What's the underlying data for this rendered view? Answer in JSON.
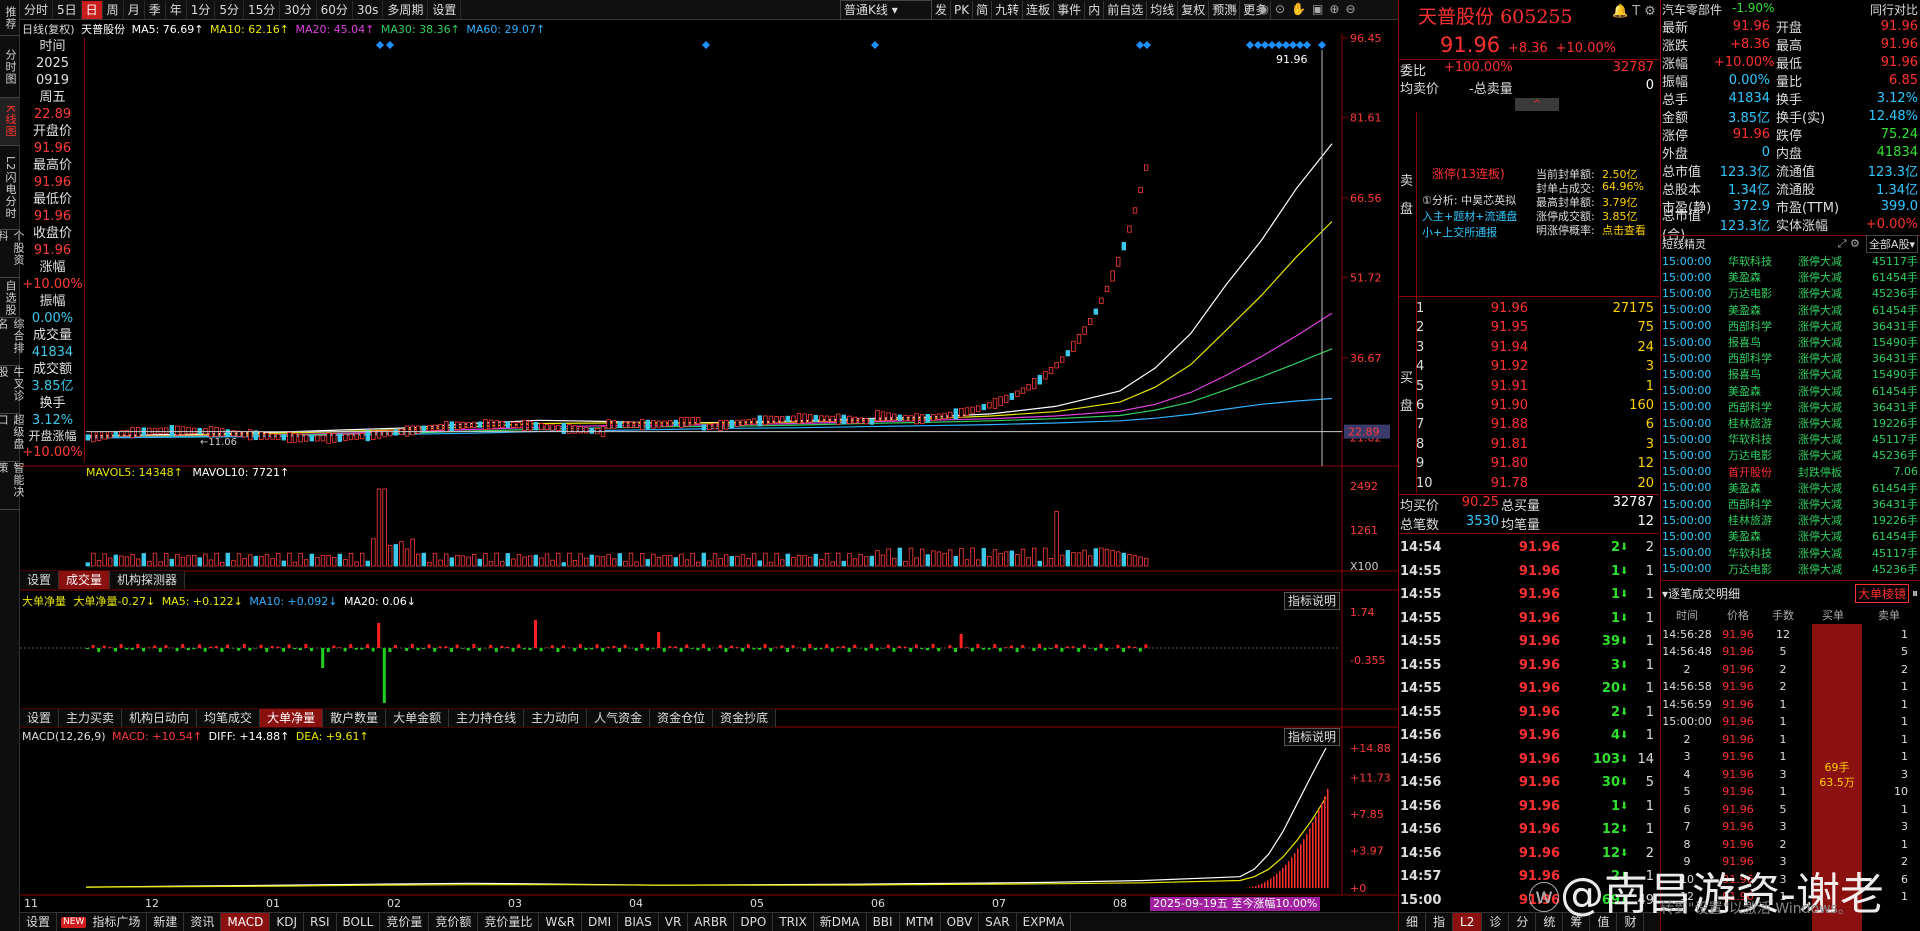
{
  "left_sidebar": [
    "推荐",
    "分时图",
    "K线图",
    "L2闪电分时",
    "个股资料",
    "自选股",
    "综合排名",
    "牛叉诊股",
    "超级盘口",
    "智能决策"
  ],
  "top_tabs": [
    "分时",
    "5日",
    "日",
    "周",
    "月",
    "季",
    "年",
    "1分",
    "5分",
    "15分",
    "30分",
    "60分",
    "30s",
    "多周期",
    "设置"
  ],
  "top_tabs_active": "日",
  "top_right": {
    "kline_type": "普通K线",
    "buttons": [
      "发",
      "PK",
      "简",
      "九转",
      "连板",
      "事件",
      "内",
      "前自选",
      "均线",
      "复权",
      "预测",
      "更多"
    ]
  },
  "stock": {
    "name": "天普股份",
    "code": "605255",
    "price": "91.96",
    "change": "+8.36",
    "change_pct": "+10.00%",
    "price_line": "91.96",
    "last_close_mark": "22.89"
  },
  "chart_header": {
    "mode": "日线(复权)",
    "name": "天普股份",
    "ma5": "MA5: 76.69↑",
    "ma10": "MA10: 62.16↑",
    "ma20": "MA20: 45.04↑",
    "ma30": "MA30: 38.36↑",
    "ma60": "MA60: 29.07↑"
  },
  "info_col": {
    "time_label": "时间",
    "year": "2025",
    "date": "0919",
    "weekday": "周五",
    "date_val": "22.89",
    "open_label": "开盘价",
    "open": "91.96",
    "high_label": "最高价",
    "high": "91.96",
    "low_label": "最低价",
    "low": "91.96",
    "close_label": "收盘价",
    "close": "91.96",
    "chg_label": "涨幅",
    "chg": "+10.00%",
    "amp_label": "振幅",
    "amp": "0.00%",
    "vol_label": "成交量",
    "vol": "41834",
    "amt_label": "成交额",
    "amt": "3.85亿",
    "turn_label": "换手",
    "turn": "3.12%",
    "open_chg_label": "开盘涨幅",
    "open_chg": "+10.00%"
  },
  "chart_data": [
    {
      "type": "line",
      "title": "日线",
      "ylim": [
        21.32,
        96.45
      ],
      "y_ticks": [
        "96.45",
        "81.61",
        "66.56",
        "51.72",
        "36.67",
        "21.82"
      ],
      "x_ticks": [
        "11",
        "12",
        "01",
        "02",
        "03",
        "04",
        "05",
        "06",
        "07",
        "08",
        "09"
      ],
      "low_mark": "11.06",
      "series": [
        {
          "name": "MA5",
          "values": [
            22.1,
            22.3,
            22.5,
            22.8,
            23.2,
            23.6,
            24.4,
            25.0,
            24.8,
            24.5,
            24.6,
            24.9,
            25.3,
            25.6,
            26.2,
            27.6,
            30.5,
            34.8,
            41.2,
            50.3,
            58.6,
            68.4,
            76.69
          ]
        },
        {
          "name": "MA10",
          "values": [
            22.0,
            22.1,
            22.3,
            22.6,
            22.9,
            23.3,
            23.8,
            24.4,
            24.5,
            24.5,
            24.5,
            24.7,
            25.0,
            25.3,
            25.8,
            26.6,
            28.4,
            31.2,
            35.4,
            41.8,
            48.3,
            55.6,
            62.16
          ]
        },
        {
          "name": "MA20",
          "values": [
            21.9,
            22.0,
            22.1,
            22.3,
            22.6,
            22.9,
            23.3,
            23.7,
            24.0,
            24.1,
            24.2,
            24.4,
            24.7,
            25.0,
            25.3,
            25.8,
            26.7,
            28.0,
            30.2,
            33.4,
            36.9,
            40.8,
            45.04
          ]
        },
        {
          "name": "MA30",
          "values": [
            21.8,
            21.9,
            22.0,
            22.2,
            22.4,
            22.6,
            23.0,
            23.3,
            23.6,
            23.8,
            23.9,
            24.1,
            24.4,
            24.6,
            24.9,
            25.3,
            25.9,
            26.9,
            28.4,
            30.7,
            33.1,
            35.7,
            38.36
          ]
        },
        {
          "name": "MA60",
          "values": [
            21.7,
            21.8,
            21.9,
            22.0,
            22.2,
            22.4,
            22.6,
            22.9,
            23.1,
            23.3,
            23.5,
            23.6,
            23.8,
            24.0,
            24.2,
            24.5,
            24.9,
            25.4,
            26.1,
            27.1,
            28.0,
            28.6,
            29.07
          ]
        }
      ]
    },
    {
      "type": "bar",
      "title": "成交量",
      "ylim": [
        0,
        2492
      ],
      "y_ticks": [
        "2492",
        "1261",
        "X100"
      ],
      "labels": {
        "mavol5": "MAVOL5: 14348↑",
        "mavol10": "MAVOL10: 7721↑"
      }
    },
    {
      "type": "bar",
      "title": "大单净量",
      "y_ticks": [
        "1.74",
        "-0.355"
      ],
      "labels": {
        "title": "大单净量",
        "val": "-0.27↓",
        "ma5": "MA5: +0.122↓",
        "ma10": "MA10: +0.092↓",
        "ma20": "MA20: 0.06↓"
      }
    },
    {
      "type": "line",
      "title": "MACD",
      "y_ticks": [
        "14.88",
        "11.73",
        "7.85",
        "3.97",
        "0"
      ],
      "labels": {
        "macd": "MACD(12,26,9)",
        "m": "MACD: +10.54↑",
        "diff": "DIFF: +14.88↑",
        "dea": "DEA: +9.61↑"
      },
      "series": [
        {
          "name": "DIFF",
          "values": [
            0.1,
            0.2,
            0.3,
            0.4,
            0.5,
            0.4,
            0.3,
            0.35,
            0.4,
            0.5,
            0.6,
            0.8,
            1.2,
            2.0,
            3.6,
            6.0,
            9.0,
            12.0,
            14.88
          ]
        },
        {
          "name": "DEA",
          "values": [
            0.1,
            0.15,
            0.2,
            0.3,
            0.35,
            0.35,
            0.3,
            0.3,
            0.32,
            0.38,
            0.45,
            0.55,
            0.8,
            1.2,
            2.0,
            3.3,
            5.1,
            7.2,
            9.61
          ]
        }
      ]
    }
  ],
  "vol_tabs": [
    "设置",
    "成交量",
    "机构探测器"
  ],
  "vol_tabs_active": "成交量",
  "capital_tabs": [
    "设置",
    "主力买卖",
    "机构日动向",
    "均笔成交",
    "大单净量",
    "散户数量",
    "大单金额",
    "主力持仓线",
    "主力动向",
    "人气资金",
    "资金仓位",
    "资金抄底"
  ],
  "capital_tabs_active": "大单净量",
  "hint_label": "指标说明",
  "bottom_tabs": [
    "设置",
    "指标广场",
    "新建",
    "资讯",
    "MACD",
    "KDJ",
    "RSI",
    "BOLL",
    "竞价量",
    "竞价额",
    "竞价量比",
    "W&R",
    "DMI",
    "BIAS",
    "VR",
    "ARBR",
    "DPO",
    "TRIX",
    "新DMA",
    "BBI",
    "MTM",
    "OBV",
    "SAR",
    "EXPMA"
  ],
  "bottom_tabs_active": "MACD",
  "bottom_new": "NEW",
  "status_strip": "2025-09-19五 至今涨幅10.00%",
  "orderbook": {
    "weibi_label": "委比",
    "weibi": "+100.00%",
    "weicha": "32787",
    "avg_sell_label": "均卖价",
    "total_sell_label": "-总卖量",
    "total_sell": "0",
    "sell_label": "卖盘",
    "buy_label": "买盘",
    "limit_status": "涨停(13连板)",
    "limit_stats": [
      [
        "当前封单额:",
        "2.50亿"
      ],
      [
        "封单占成交:",
        "64.96%"
      ],
      [
        "最高封单额:",
        "3.79亿"
      ],
      [
        "涨停成交额:",
        "3.85亿"
      ],
      [
        "明涨停概率:",
        "点击查看"
      ]
    ],
    "analysis_lines": [
      "①分析: 中昊芯英拟",
      "入主+题材+流通盘",
      "小+上交所通报"
    ],
    "bids": [
      [
        "1",
        "91.96",
        "27175"
      ],
      [
        "2",
        "91.95",
        "75"
      ],
      [
        "3",
        "91.94",
        "24"
      ],
      [
        "4",
        "91.92",
        "3"
      ],
      [
        "5",
        "91.91",
        "1"
      ],
      [
        "6",
        "91.90",
        "160"
      ],
      [
        "7",
        "91.88",
        "6"
      ],
      [
        "8",
        "91.81",
        "3"
      ],
      [
        "9",
        "91.80",
        "12"
      ],
      [
        "10",
        "91.78",
        "20"
      ]
    ],
    "avg_buy_label": "均买价",
    "avg_buy": "90.25",
    "total_buy_label": "总买量",
    "total_buy": "32787",
    "total_count_label": "总笔数",
    "total_count": "3530",
    "avg_lot_label": "均笔量",
    "avg_lot": "12"
  },
  "trades": [
    [
      "14:54",
      "91.96",
      "2",
      "2"
    ],
    [
      "14:55",
      "91.96",
      "1",
      "1"
    ],
    [
      "14:55",
      "91.96",
      "1",
      "1"
    ],
    [
      "14:55",
      "91.96",
      "1",
      "1"
    ],
    [
      "14:55",
      "91.96",
      "39",
      "1"
    ],
    [
      "14:55",
      "91.96",
      "3",
      "1"
    ],
    [
      "14:55",
      "91.96",
      "20",
      "1"
    ],
    [
      "14:55",
      "91.96",
      "2",
      "1"
    ],
    [
      "14:56",
      "91.96",
      "4",
      "1"
    ],
    [
      "14:56",
      "91.96",
      "103",
      "14"
    ],
    [
      "14:56",
      "91.96",
      "30",
      "5"
    ],
    [
      "14:56",
      "91.96",
      "1",
      "1"
    ],
    [
      "14:56",
      "91.96",
      "12",
      "1"
    ],
    [
      "14:56",
      "91.96",
      "12",
      "2"
    ],
    [
      "14:57",
      "91.96",
      "2",
      "1"
    ],
    [
      "15:00",
      "91.96",
      "69",
      "49"
    ]
  ],
  "right_footer_tabs": [
    "细",
    "指",
    "L2",
    "诊",
    "分",
    "统",
    "筹",
    "值",
    "财"
  ],
  "quote": {
    "sector": "汽车零部件",
    "sector_chg": "-1.90%",
    "peer_btn": "同行对比",
    "grid": [
      [
        "最新",
        "91.96",
        "开盘",
        "91.96"
      ],
      [
        "涨跌",
        "+8.36",
        "最高",
        "91.96"
      ],
      [
        "涨幅",
        "+10.00%",
        "最低",
        "91.96"
      ],
      [
        "振幅",
        "0.00%",
        "量比",
        "6.85"
      ],
      [
        "总手",
        "41834",
        "换手",
        "3.12%"
      ],
      [
        "金额",
        "3.85亿",
        "换手(实)",
        "12.48%"
      ],
      [
        "涨停",
        "91.96",
        "跌停",
        "75.24"
      ],
      [
        "外盘",
        "0",
        "内盘",
        "41834"
      ],
      [
        "总市值",
        "123.3亿",
        "流通值",
        "123.3亿"
      ],
      [
        "总股本",
        "1.34亿",
        "流通股",
        "1.34亿"
      ],
      [
        "市盈(静)",
        "372.9",
        "市盈(TTM)",
        "399.0"
      ],
      [
        "总市值(合)",
        "123.3亿",
        "实体涨幅",
        "+0.00%"
      ]
    ]
  },
  "short_elf": {
    "title": "短线精灵",
    "market": "全部A股"
  },
  "ticks": [
    [
      "15:00:00",
      "华软科技",
      "涨停大减",
      "45117手"
    ],
    [
      "15:00:00",
      "美盈森",
      "涨停大减",
      "61454手"
    ],
    [
      "15:00:00",
      "万达电影",
      "涨停大减",
      "45236手"
    ],
    [
      "15:00:00",
      "美盈森",
      "涨停大减",
      "61454手"
    ],
    [
      "15:00:00",
      "西部科学",
      "涨停大减",
      "36431手"
    ],
    [
      "15:00:00",
      "报喜鸟",
      "涨停大减",
      "15490手"
    ],
    [
      "15:00:00",
      "西部科学",
      "涨停大减",
      "36431手"
    ],
    [
      "15:00:00",
      "报喜鸟",
      "涨停大减",
      "15490手"
    ],
    [
      "15:00:00",
      "美盈森",
      "涨停大减",
      "61454手"
    ],
    [
      "15:00:00",
      "西部科学",
      "涨停大减",
      "36431手"
    ],
    [
      "15:00:00",
      "桂林旅游",
      "涨停大减",
      "19226手"
    ],
    [
      "15:00:00",
      "华软科技",
      "涨停大减",
      "45117手"
    ],
    [
      "15:00:00",
      "万达电影",
      "涨停大减",
      "45236手"
    ],
    [
      "15:00:00",
      "首开股份",
      "封跌停板",
      "7.06"
    ],
    [
      "15:00:00",
      "美盈森",
      "涨停大减",
      "61454手"
    ],
    [
      "15:00:00",
      "西部科学",
      "涨停大减",
      "36431手"
    ],
    [
      "15:00:00",
      "桂林旅游",
      "涨停大减",
      "19226手"
    ],
    [
      "15:00:00",
      "美盈森",
      "涨停大减",
      "61454手"
    ],
    [
      "15:00:00",
      "华软科技",
      "涨停大减",
      "45117手"
    ],
    [
      "15:00:00",
      "万达电影",
      "涨停大减",
      "45236手"
    ]
  ],
  "trade_detail": {
    "title": "逐笔成交明细",
    "btn": "大单棱镜",
    "headers": [
      "时间",
      "价格",
      "手数",
      "买单",
      "卖单"
    ],
    "rows": [
      [
        "14:56:28",
        "91.96",
        "12",
        "1"
      ],
      [
        "14:56:48",
        "91.96",
        "5",
        "5"
      ],
      [
        "2",
        "91.96",
        "2",
        "2"
      ],
      [
        "14:56:58",
        "91.96",
        "2",
        "1"
      ],
      [
        "14:56:59",
        "91.96",
        "1",
        "1"
      ],
      [
        "15:00:00",
        "91.96",
        "1",
        "1"
      ],
      [
        "2",
        "91.96",
        "1",
        "1"
      ],
      [
        "3",
        "91.96",
        "1",
        "1"
      ],
      [
        "4",
        "91.96",
        "3",
        "3"
      ],
      [
        "5",
        "91.96",
        "1",
        "10"
      ],
      [
        "6",
        "91.96",
        "5",
        "1"
      ],
      [
        "7",
        "91.96",
        "3",
        "3"
      ],
      [
        "8",
        "91.96",
        "2",
        "1"
      ],
      [
        "9",
        "91.96",
        "3",
        "2"
      ],
      [
        "10",
        "91.96",
        "3",
        "6"
      ],
      [
        "12",
        "91.96",
        "1",
        "1"
      ]
    ],
    "big_order": "69手",
    "big_amt": "63.5万"
  },
  "watermark": "@南昌游资-谢老",
  "win_watermark": "转到\"设置\"以激活 Windows。"
}
